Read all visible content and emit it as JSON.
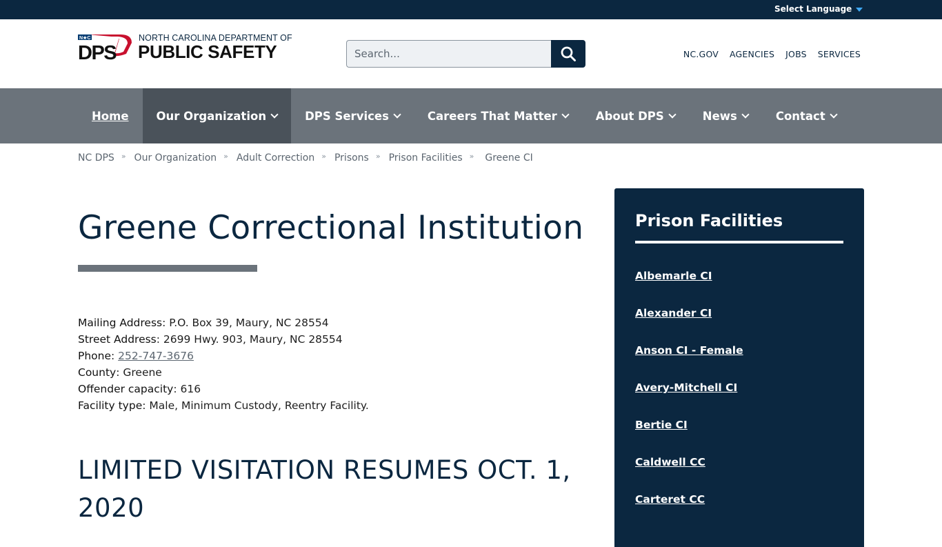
{
  "topbar": {
    "language_label": "Select Language"
  },
  "header": {
    "logo_small_text": "NORTH CAROLINA DEPARTMENT OF",
    "logo_large_text": "PUBLIC SAFETY",
    "logo_mark_text": "DPS",
    "logo_badge_text": "N★C",
    "search_placeholder": "Search...",
    "utility_links": [
      "NC.GOV",
      "AGENCIES",
      "JOBS",
      "SERVICES"
    ]
  },
  "nav": {
    "items": [
      {
        "label": "Home",
        "has_menu": false
      },
      {
        "label": "Our Organization",
        "has_menu": true
      },
      {
        "label": "DPS Services",
        "has_menu": true
      },
      {
        "label": "Careers That Matter",
        "has_menu": true
      },
      {
        "label": "About DPS",
        "has_menu": true
      },
      {
        "label": "News",
        "has_menu": true
      },
      {
        "label": "Contact",
        "has_menu": true
      }
    ]
  },
  "breadcrumb": [
    "NC DPS",
    "Our Organization",
    "Adult Correction",
    "Prisons",
    "Prison Facilities",
    "Greene CI"
  ],
  "main": {
    "title": "Greene Correctional Institution",
    "facts": {
      "mailing_label": "Mailing Address",
      "mailing_value": ": P.O. Box 39, Maury, NC 28554",
      "street_label": "Street Address",
      "street_value": ": 2699 Hwy. 903, Maury, NC 28554",
      "phone_label": "Phone",
      "phone_sep": ": ",
      "phone_value": "252-747-3676",
      "county_label": "County",
      "county_value": ": Greene",
      "capacity_label": "Offender capacity",
      "capacity_value": ": 616",
      "type_label": "Facility type",
      "type_value": ": Male, Minimum Custody, Reentry Facility."
    },
    "section_heading": "LIMITED VISITATION RESUMES OCT. 1, 2020"
  },
  "sidebar": {
    "title": "Prison Facilities",
    "items": [
      "Albemarle CI",
      "Alexander CI",
      "Anson CI - Female",
      "Avery-Mitchell CI",
      "Bertie CI",
      "Caldwell CC",
      "Carteret CC"
    ]
  },
  "colors": {
    "navy": "#0b2740",
    "nav_gray": "#6b737b",
    "nav_active": "#4a525a",
    "logo_red": "#c8102e",
    "logo_blue": "#003a70"
  }
}
